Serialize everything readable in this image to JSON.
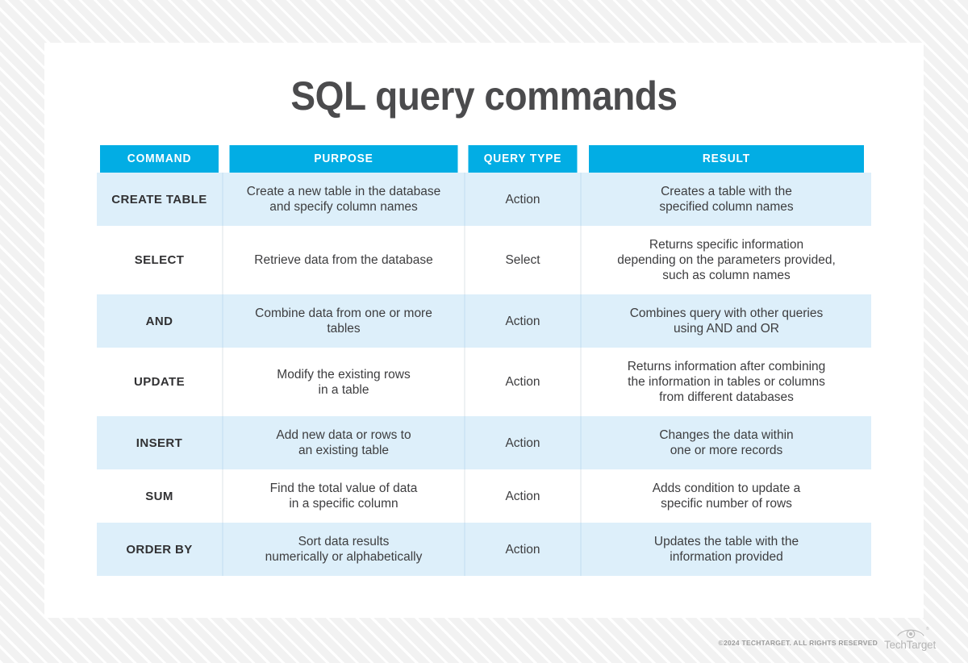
{
  "page": {
    "title": "SQL query commands"
  },
  "theme": {
    "header_blue": "#02ade4",
    "row_light_blue": "#ddeffa",
    "row_white": "#ffffff",
    "title_color": "#4b4b4d",
    "body_text_color": "#3d3d3f",
    "background_gray": "#f2f2f2"
  },
  "table": {
    "columns": [
      {
        "key": "command",
        "label": "COMMAND"
      },
      {
        "key": "purpose",
        "label": "PURPOSE"
      },
      {
        "key": "query_type",
        "label": "QUERY TYPE"
      },
      {
        "key": "result",
        "label": "RESULT"
      }
    ],
    "rows": [
      {
        "command": "CREATE TABLE",
        "purpose": "Create a new table in the database\nand specify column names",
        "query_type": "Action",
        "result": "Creates a table with the\nspecified column names"
      },
      {
        "command": "SELECT",
        "purpose": "Retrieve data from the database",
        "query_type": "Select",
        "result": "Returns specific information\ndepending on the parameters provided,\nsuch as column names"
      },
      {
        "command": "AND",
        "purpose": "Combine data from one or more\ntables",
        "query_type": "Action",
        "result": "Combines query with other queries\nusing AND and OR"
      },
      {
        "command": "UPDATE",
        "purpose": "Modify the existing rows\nin a table",
        "query_type": "Action",
        "result": "Returns information after combining\nthe information in tables or columns\nfrom different databases"
      },
      {
        "command": "INSERT",
        "purpose": "Add new data or rows to\nan existing table",
        "query_type": "Action",
        "result": "Changes the data within\none or more records"
      },
      {
        "command": "SUM",
        "purpose": "Find the total value of data\nin a specific column",
        "query_type": "Action",
        "result": "Adds condition to update a\nspecific number of rows"
      },
      {
        "command": "ORDER BY",
        "purpose": "Sort data results\nnumerically or alphabetically",
        "query_type": "Action",
        "result": "Updates the table with the\ninformation provided"
      }
    ]
  },
  "footer": {
    "copyright": "©2024 TECHTARGET. ALL RIGHTS RESERVED",
    "brand": "TechTarget",
    "registered_mark": "®",
    "logo_icon": "eye-icon"
  }
}
